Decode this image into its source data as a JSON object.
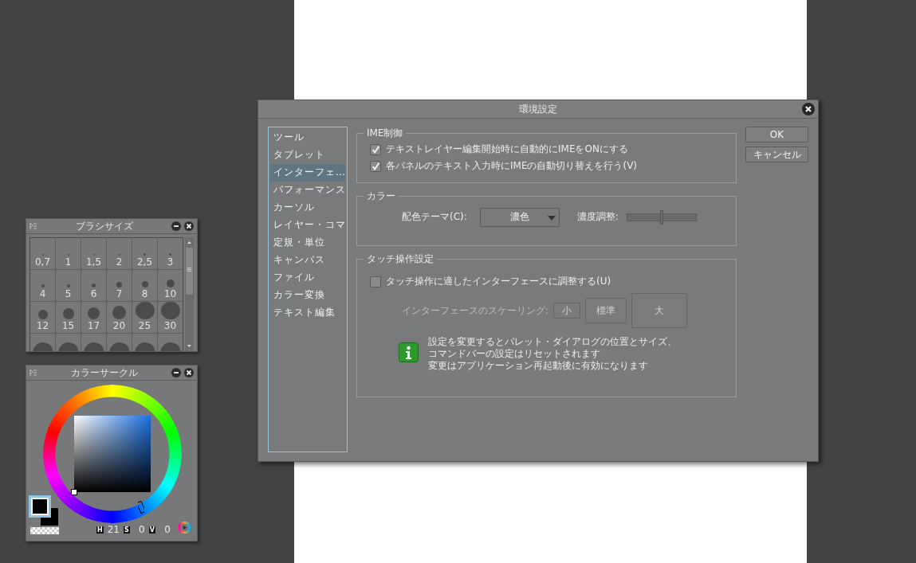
{
  "brush_palette": {
    "title": "ブラシサイズ",
    "sizes": [
      "0,7",
      "1",
      "1,5",
      "2",
      "2,5",
      "3",
      "4",
      "5",
      "6",
      "7",
      "8",
      "10",
      "12",
      "15",
      "17",
      "20",
      "25",
      "30"
    ]
  },
  "color_palette": {
    "title": "カラーサークル",
    "readouts": [
      {
        "key": "H",
        "value": "21"
      },
      {
        "key": "S",
        "value": "0"
      },
      {
        "key": "V",
        "value": "0"
      }
    ]
  },
  "dialog": {
    "title": "環境設定",
    "sidebar": {
      "items": [
        {
          "label": "ツール",
          "selected": false
        },
        {
          "label": "タブレット",
          "selected": false
        },
        {
          "label": "インターフェ…",
          "selected": true
        },
        {
          "label": "パフォーマンス",
          "selected": false
        },
        {
          "label": "カーソル",
          "selected": false
        },
        {
          "label": "レイヤー・コマ",
          "selected": false
        },
        {
          "label": "定規・単位",
          "selected": false
        },
        {
          "label": "キャンバス",
          "selected": false
        },
        {
          "label": "ファイル",
          "selected": false
        },
        {
          "label": "カラー変換",
          "selected": false
        },
        {
          "label": "テキスト編集",
          "selected": false
        }
      ]
    },
    "ime_group": {
      "title": "IME制御",
      "options": [
        {
          "label": "テキストレイヤー編集開始時に自動的にIMEをONにする",
          "checked": true
        },
        {
          "label": "各パネルのテキスト入力時にIMEの自動切り替えを行う(V)",
          "checked": true
        }
      ]
    },
    "color_group": {
      "title": "カラー",
      "theme_label": "配色テーマ(C):",
      "theme_value": "濃色",
      "density_label": "濃度調整:",
      "density": {
        "level": 0.5
      }
    },
    "touch_group": {
      "title": "タッチ操作設定",
      "option": {
        "label": "タッチ操作に適したインターフェースに調整する(U)",
        "checked": false
      },
      "scaling": {
        "label": "インターフェースのスケーリング:",
        "disabled": true,
        "options": [
          "小",
          "標準",
          "大"
        ]
      },
      "notice": [
        "設定を変更するとパレット・ダイアログの位置とサイズ、",
        "コマンドバーの設定はリセットされます",
        "変更はアプリケーション再起動後に有効になります"
      ]
    },
    "buttons": [
      "OK",
      "キャンセル"
    ]
  }
}
